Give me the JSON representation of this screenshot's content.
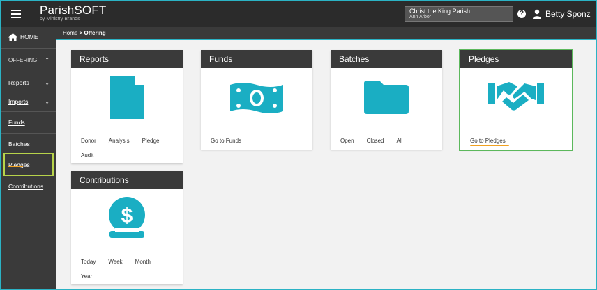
{
  "header": {
    "logo_main": "ParishSOFT",
    "logo_sub": "by Ministry Brands",
    "parish_name": "Christ the King Parish",
    "parish_city": "Ann Arbor",
    "help_label": "?",
    "user_name": "Betty Sponz"
  },
  "sidebar": {
    "home": "HOME",
    "offering": "OFFERING",
    "items": [
      {
        "label": "Reports"
      },
      {
        "label": "Imports"
      },
      {
        "label": "Funds"
      },
      {
        "label": "Batches"
      },
      {
        "label": "Pledges"
      },
      {
        "label": "Contributions"
      }
    ]
  },
  "breadcrumb": {
    "home": "Home",
    "separator": ">",
    "current": "Offering"
  },
  "cards": {
    "reports": {
      "title": "Reports",
      "links": [
        "Donor",
        "Analysis",
        "Pledge",
        "Audit"
      ]
    },
    "funds": {
      "title": "Funds",
      "links": [
        "Go to Funds"
      ]
    },
    "batches": {
      "title": "Batches",
      "links": [
        "Open",
        "Closed",
        "All"
      ]
    },
    "pledges": {
      "title": "Pledges",
      "links": [
        "Go to Pledges"
      ]
    },
    "contributions": {
      "title": "Contributions",
      "links": [
        "Today",
        "Week",
        "Month",
        "Year"
      ]
    }
  },
  "colors": {
    "accent": "#1aaec3",
    "highlight": "#b7d34a",
    "underline": "#f0a020",
    "header": "#2b2b2b"
  },
  "icons": [
    "menu-icon",
    "help-icon",
    "user-icon",
    "home-icon",
    "document-icon",
    "money-icon",
    "folder-icon",
    "handshake-icon",
    "dollar-coin-icon"
  ]
}
